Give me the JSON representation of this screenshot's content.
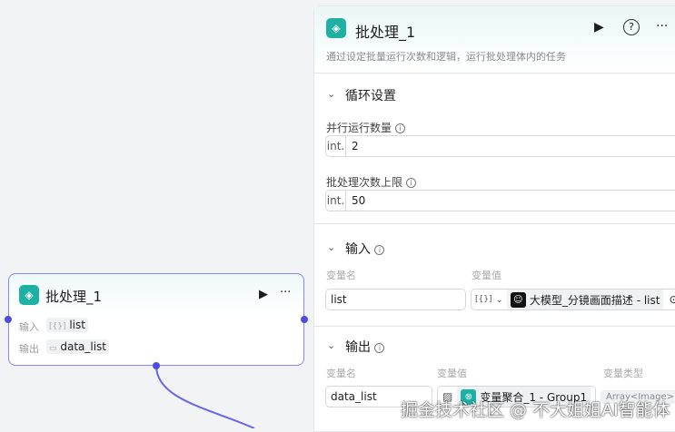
{
  "node": {
    "title": "批处理_1",
    "input_label": "输入",
    "input_value": "list",
    "input_icon": "[{}]",
    "output_label": "输出",
    "output_value": "data_list"
  },
  "panel": {
    "title": "批处理_1",
    "description": "通过设定批量运行次数和逻辑，运行批处理体内的任务",
    "loop_section": "循环设置",
    "parallel_label": "并行运行数量",
    "parallel_type": "int.",
    "parallel_value": "2",
    "limit_label": "批处理次数上限",
    "limit_type": "int.",
    "limit_value": "50",
    "input_section": "输入",
    "var_name_header": "变量名",
    "var_value_header": "变量值",
    "input_name": "list",
    "input_type_icon": "[{}]",
    "input_ref": "大模型_分镜画面描述 - list",
    "output_section": "输出",
    "var_type_header": "变量类型",
    "output_name": "data_list",
    "output_ref": "变量聚合_1 - Group1",
    "output_type": "Array<Image>"
  },
  "watermark": "掘金技术社区 @ 不大姐姐AI智能体",
  "colors": {
    "accent": "#4d4ee0",
    "app": "#1db0a3"
  }
}
